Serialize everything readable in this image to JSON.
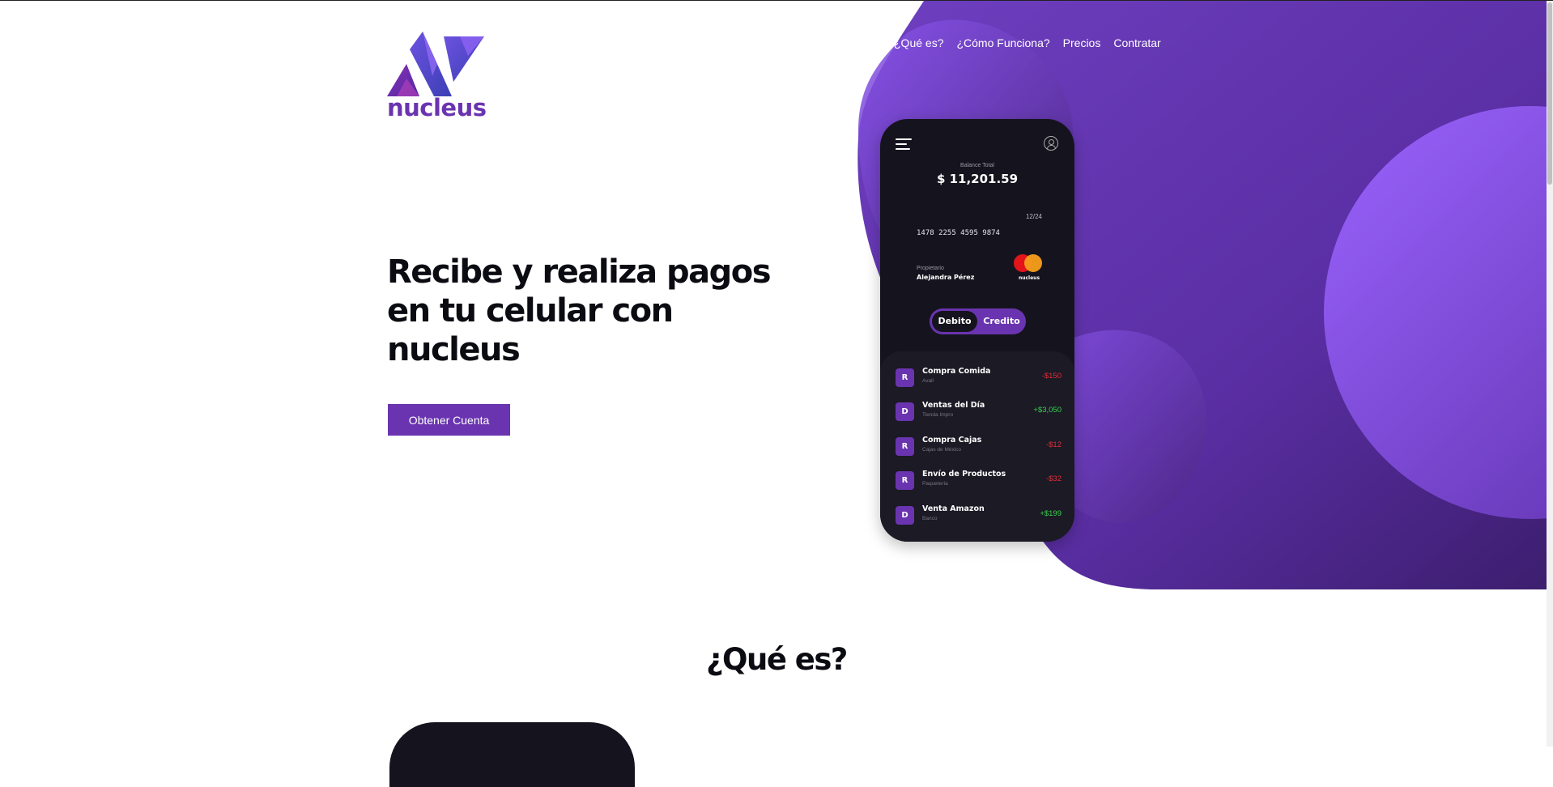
{
  "brand": {
    "name": "nucleus"
  },
  "nav": {
    "items": [
      {
        "label": "¿Qué es?"
      },
      {
        "label": "¿Cómo Funciona?"
      },
      {
        "label": "Precios"
      },
      {
        "label": "Contratar"
      }
    ]
  },
  "hero": {
    "headline": "Recibe y realiza pagos en tu celular con nucleus",
    "cta_label": "Obtener Cuenta"
  },
  "phone": {
    "balance_label": "Balance Total",
    "balance_value": "$ 11,201.59",
    "card": {
      "expiry": "12/24",
      "number": "1478 2255 4595 9874",
      "owner_label": "Propietario",
      "owner_name": "Alejandra Pérez",
      "brand": "nucleus"
    },
    "toggle": {
      "active": "Debito",
      "inactive": "Credito"
    },
    "transactions": [
      {
        "badge": "R",
        "title": "Compra Comida",
        "subtitle": "Avall",
        "amount": "-$150",
        "type": "negative"
      },
      {
        "badge": "D",
        "title": "Ventas del Día",
        "subtitle": "Tienda Impro",
        "amount": "+$3,050",
        "type": "positive"
      },
      {
        "badge": "R",
        "title": "Compra Cajas",
        "subtitle": "Cajas de México",
        "amount": "-$12",
        "type": "negative"
      },
      {
        "badge": "R",
        "title": "Envío de Productos",
        "subtitle": "Paquetería",
        "amount": "-$32",
        "type": "negative"
      },
      {
        "badge": "D",
        "title": "Venta Amazon",
        "subtitle": "Banco",
        "amount": "+$199",
        "type": "positive"
      }
    ]
  },
  "section": {
    "title": "¿Qué es?"
  },
  "colors": {
    "accent": "#6a34b0",
    "dark": "#15141e",
    "negative": "#e12f3a",
    "positive": "#39d34c",
    "text": "#0b0b12"
  },
  "icons": [
    "menu-icon",
    "user-icon",
    "mastercard-icon",
    "logo-icon"
  ]
}
